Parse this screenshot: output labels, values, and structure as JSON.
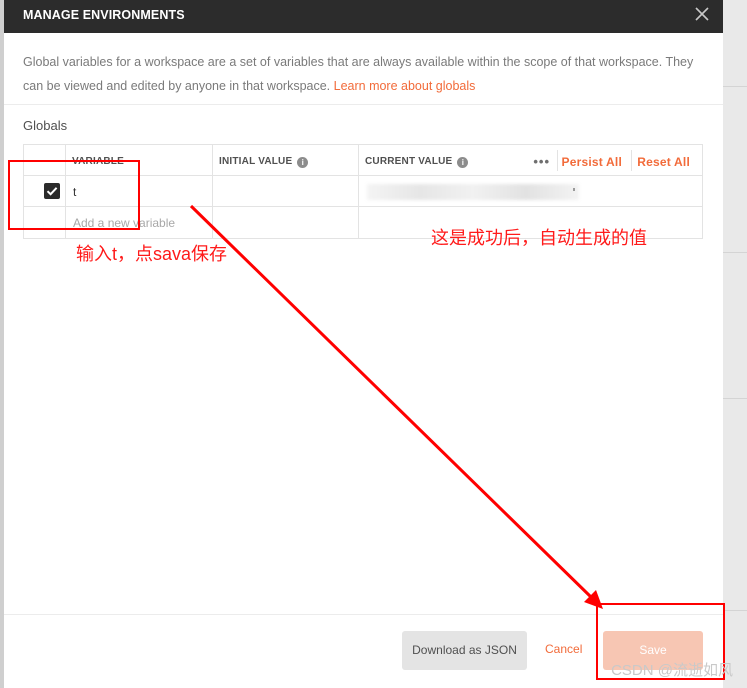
{
  "modal": {
    "title": "MANAGE ENVIRONMENTS",
    "close_icon": "close-icon",
    "description": "Global variables for a workspace are a set of variables that are always available within the scope of that workspace. They can be viewed and edited by anyone in that workspace. ",
    "learn_more": "Learn more about globals",
    "section_title": "Globals"
  },
  "table": {
    "headers": {
      "variable": "VARIABLE",
      "initial_value": "INITIAL VALUE",
      "current_value": "CURRENT VALUE",
      "info_icon": "info-icon",
      "more": "•••",
      "persist_all": "Persist All",
      "reset_all": "Reset All"
    },
    "rows": [
      {
        "checked": true,
        "variable": "t",
        "initial_value": "",
        "current_value": ""
      }
    ],
    "add_placeholder": "Add a new variable"
  },
  "footer": {
    "download": "Download as JSON",
    "cancel": "Cancel",
    "save": "Save"
  },
  "annotations": {
    "left_note": "输入t，点sava保存",
    "right_note": "这是成功后，自动生成的值",
    "color": "#ff0000"
  },
  "watermark": "CSDN @流逝如风",
  "colors": {
    "header_bg": "#2c2c2c",
    "accent": "#f26b3a",
    "save_disabled": "#f7c6b3"
  }
}
